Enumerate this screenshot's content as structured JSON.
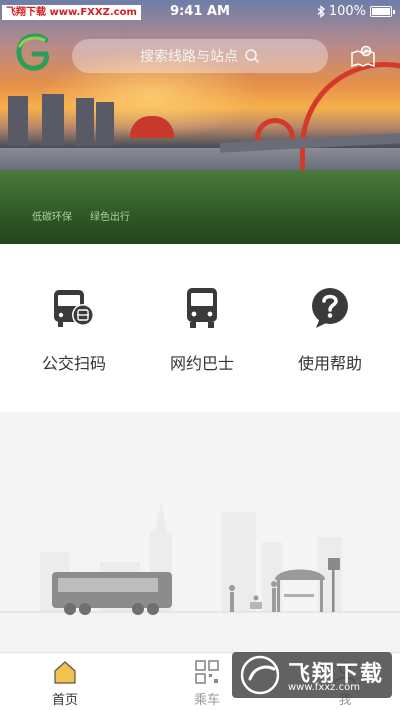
{
  "status_bar": {
    "source_tag": "飞翔下载 www.FXXZ.com",
    "time": "9:41 AM",
    "battery": "100%",
    "bluetooth_icon": "bluetooth-icon"
  },
  "header": {
    "logo_icon": "city-bus-logo-icon",
    "search_placeholder": "搜索线路与站点",
    "search_icon": "search-icon",
    "map_icon": "map-location-icon"
  },
  "banner": {
    "tag_left": "低碳环保",
    "tag_right": "绿色出行"
  },
  "menu": {
    "items": [
      {
        "label": "公交扫码",
        "icon": "bus-scan-icon"
      },
      {
        "label": "网约巴士",
        "icon": "bus-icon"
      },
      {
        "label": "使用帮助",
        "icon": "help-icon"
      }
    ]
  },
  "tabbar": {
    "tabs": [
      {
        "label": "首页",
        "icon": "home-icon",
        "active": true
      },
      {
        "label": "乘车",
        "icon": "qr-code-icon",
        "active": false
      },
      {
        "label": "我",
        "icon": "user-icon",
        "active": false
      }
    ]
  },
  "watermark": {
    "title": "飞翔下载",
    "url": "www.fxxz.com"
  },
  "colors": {
    "primary_dark": "#3a3a3a",
    "logo_green": "#2e9c5a",
    "tab_active": "#f2c14e"
  }
}
